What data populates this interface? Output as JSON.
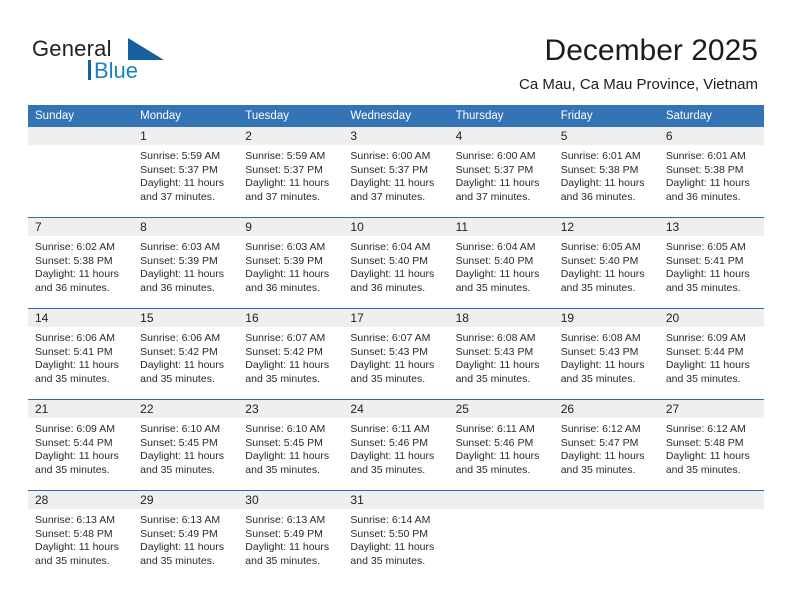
{
  "brand": {
    "name_part1": "General",
    "name_part2": "Blue"
  },
  "header": {
    "title": "December 2025",
    "subtitle": "Ca Mau, Ca Mau Province, Vietnam"
  },
  "colors": {
    "header_blue": "#3373b6",
    "separator_blue": "#2e6da9",
    "day_band_gray": "#efefef",
    "brand_blue": "#1f7fc4"
  },
  "weekdays": [
    "Sunday",
    "Monday",
    "Tuesday",
    "Wednesday",
    "Thursday",
    "Friday",
    "Saturday"
  ],
  "weeks": [
    [
      {
        "day": "",
        "sunrise": "",
        "sunset": "",
        "daylight": "",
        "empty": true
      },
      {
        "day": "1",
        "sunrise": "Sunrise: 5:59 AM",
        "sunset": "Sunset: 5:37 PM",
        "daylight": "Daylight: 11 hours and 37 minutes."
      },
      {
        "day": "2",
        "sunrise": "Sunrise: 5:59 AM",
        "sunset": "Sunset: 5:37 PM",
        "daylight": "Daylight: 11 hours and 37 minutes."
      },
      {
        "day": "3",
        "sunrise": "Sunrise: 6:00 AM",
        "sunset": "Sunset: 5:37 PM",
        "daylight": "Daylight: 11 hours and 37 minutes."
      },
      {
        "day": "4",
        "sunrise": "Sunrise: 6:00 AM",
        "sunset": "Sunset: 5:37 PM",
        "daylight": "Daylight: 11 hours and 37 minutes."
      },
      {
        "day": "5",
        "sunrise": "Sunrise: 6:01 AM",
        "sunset": "Sunset: 5:38 PM",
        "daylight": "Daylight: 11 hours and 36 minutes."
      },
      {
        "day": "6",
        "sunrise": "Sunrise: 6:01 AM",
        "sunset": "Sunset: 5:38 PM",
        "daylight": "Daylight: 11 hours and 36 minutes."
      }
    ],
    [
      {
        "day": "7",
        "sunrise": "Sunrise: 6:02 AM",
        "sunset": "Sunset: 5:38 PM",
        "daylight": "Daylight: 11 hours and 36 minutes."
      },
      {
        "day": "8",
        "sunrise": "Sunrise: 6:03 AM",
        "sunset": "Sunset: 5:39 PM",
        "daylight": "Daylight: 11 hours and 36 minutes."
      },
      {
        "day": "9",
        "sunrise": "Sunrise: 6:03 AM",
        "sunset": "Sunset: 5:39 PM",
        "daylight": "Daylight: 11 hours and 36 minutes."
      },
      {
        "day": "10",
        "sunrise": "Sunrise: 6:04 AM",
        "sunset": "Sunset: 5:40 PM",
        "daylight": "Daylight: 11 hours and 36 minutes."
      },
      {
        "day": "11",
        "sunrise": "Sunrise: 6:04 AM",
        "sunset": "Sunset: 5:40 PM",
        "daylight": "Daylight: 11 hours and 35 minutes."
      },
      {
        "day": "12",
        "sunrise": "Sunrise: 6:05 AM",
        "sunset": "Sunset: 5:40 PM",
        "daylight": "Daylight: 11 hours and 35 minutes."
      },
      {
        "day": "13",
        "sunrise": "Sunrise: 6:05 AM",
        "sunset": "Sunset: 5:41 PM",
        "daylight": "Daylight: 11 hours and 35 minutes."
      }
    ],
    [
      {
        "day": "14",
        "sunrise": "Sunrise: 6:06 AM",
        "sunset": "Sunset: 5:41 PM",
        "daylight": "Daylight: 11 hours and 35 minutes."
      },
      {
        "day": "15",
        "sunrise": "Sunrise: 6:06 AM",
        "sunset": "Sunset: 5:42 PM",
        "daylight": "Daylight: 11 hours and 35 minutes."
      },
      {
        "day": "16",
        "sunrise": "Sunrise: 6:07 AM",
        "sunset": "Sunset: 5:42 PM",
        "daylight": "Daylight: 11 hours and 35 minutes."
      },
      {
        "day": "17",
        "sunrise": "Sunrise: 6:07 AM",
        "sunset": "Sunset: 5:43 PM",
        "daylight": "Daylight: 11 hours and 35 minutes."
      },
      {
        "day": "18",
        "sunrise": "Sunrise: 6:08 AM",
        "sunset": "Sunset: 5:43 PM",
        "daylight": "Daylight: 11 hours and 35 minutes."
      },
      {
        "day": "19",
        "sunrise": "Sunrise: 6:08 AM",
        "sunset": "Sunset: 5:43 PM",
        "daylight": "Daylight: 11 hours and 35 minutes."
      },
      {
        "day": "20",
        "sunrise": "Sunrise: 6:09 AM",
        "sunset": "Sunset: 5:44 PM",
        "daylight": "Daylight: 11 hours and 35 minutes."
      }
    ],
    [
      {
        "day": "21",
        "sunrise": "Sunrise: 6:09 AM",
        "sunset": "Sunset: 5:44 PM",
        "daylight": "Daylight: 11 hours and 35 minutes."
      },
      {
        "day": "22",
        "sunrise": "Sunrise: 6:10 AM",
        "sunset": "Sunset: 5:45 PM",
        "daylight": "Daylight: 11 hours and 35 minutes."
      },
      {
        "day": "23",
        "sunrise": "Sunrise: 6:10 AM",
        "sunset": "Sunset: 5:45 PM",
        "daylight": "Daylight: 11 hours and 35 minutes."
      },
      {
        "day": "24",
        "sunrise": "Sunrise: 6:11 AM",
        "sunset": "Sunset: 5:46 PM",
        "daylight": "Daylight: 11 hours and 35 minutes."
      },
      {
        "day": "25",
        "sunrise": "Sunrise: 6:11 AM",
        "sunset": "Sunset: 5:46 PM",
        "daylight": "Daylight: 11 hours and 35 minutes."
      },
      {
        "day": "26",
        "sunrise": "Sunrise: 6:12 AM",
        "sunset": "Sunset: 5:47 PM",
        "daylight": "Daylight: 11 hours and 35 minutes."
      },
      {
        "day": "27",
        "sunrise": "Sunrise: 6:12 AM",
        "sunset": "Sunset: 5:48 PM",
        "daylight": "Daylight: 11 hours and 35 minutes."
      }
    ],
    [
      {
        "day": "28",
        "sunrise": "Sunrise: 6:13 AM",
        "sunset": "Sunset: 5:48 PM",
        "daylight": "Daylight: 11 hours and 35 minutes."
      },
      {
        "day": "29",
        "sunrise": "Sunrise: 6:13 AM",
        "sunset": "Sunset: 5:49 PM",
        "daylight": "Daylight: 11 hours and 35 minutes."
      },
      {
        "day": "30",
        "sunrise": "Sunrise: 6:13 AM",
        "sunset": "Sunset: 5:49 PM",
        "daylight": "Daylight: 11 hours and 35 minutes."
      },
      {
        "day": "31",
        "sunrise": "Sunrise: 6:14 AM",
        "sunset": "Sunset: 5:50 PM",
        "daylight": "Daylight: 11 hours and 35 minutes."
      },
      {
        "day": "",
        "sunrise": "",
        "sunset": "",
        "daylight": "",
        "empty": true
      },
      {
        "day": "",
        "sunrise": "",
        "sunset": "",
        "daylight": "",
        "empty": true
      },
      {
        "day": "",
        "sunrise": "",
        "sunset": "",
        "daylight": "",
        "empty": true
      }
    ]
  ]
}
